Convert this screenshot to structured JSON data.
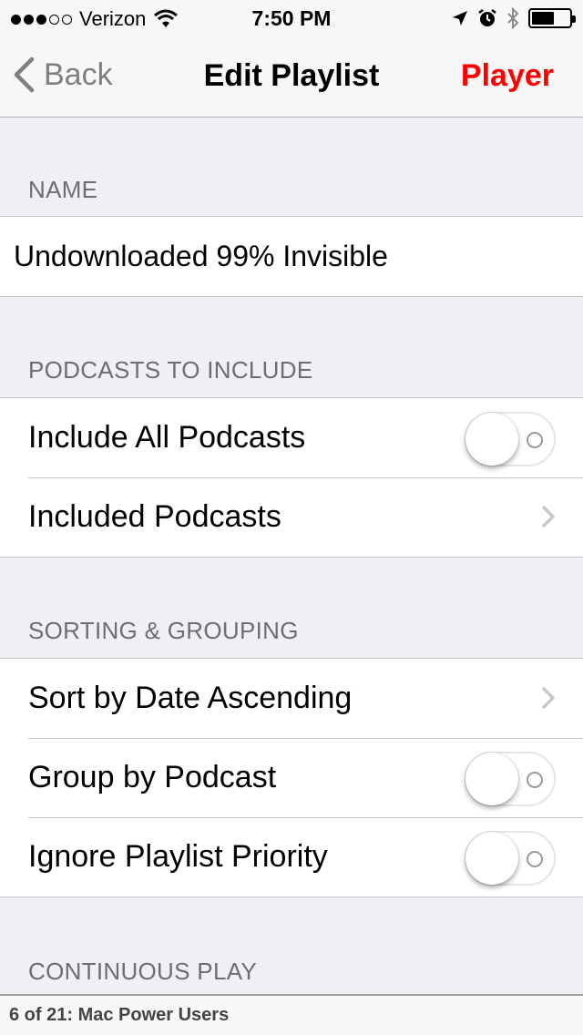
{
  "status_bar": {
    "carrier": "Verizon",
    "time": "7:50 PM",
    "signal_bars_filled": 3,
    "signal_bars_total": 5,
    "battery_level": 0.6
  },
  "nav": {
    "back_label": "Back",
    "title": "Edit Playlist",
    "player_label": "Player"
  },
  "sections": {
    "name": {
      "header": "NAME",
      "value": "Undownloaded 99% Invisible"
    },
    "podcasts": {
      "header": "PODCASTS TO INCLUDE",
      "include_all_label": "Include All Podcasts",
      "include_all_on": false,
      "included_label": "Included Podcasts"
    },
    "sorting": {
      "header": "SORTING & GROUPING",
      "sort_label": "Sort by Date Ascending",
      "group_label": "Group by Podcast",
      "group_on": false,
      "ignore_label": "Ignore Playlist Priority",
      "ignore_on": false
    },
    "continuous": {
      "header": "CONTINUOUS PLAY"
    }
  },
  "now_playing": {
    "text": "6 of 21: Mac Power Users"
  },
  "colors": {
    "accent": "#ff0000",
    "background": "#efeff4",
    "section_text": "#6d6d72"
  }
}
